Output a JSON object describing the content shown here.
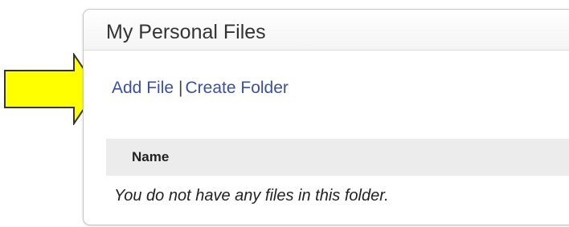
{
  "panel": {
    "title": "My Personal Files"
  },
  "actions": {
    "add_file_label": "Add File",
    "separator": "|",
    "create_folder_label": "Create Folder"
  },
  "table": {
    "columns": [
      "Name"
    ],
    "empty_message": "You do not have any files in this folder."
  },
  "annotation": {
    "arrow_icon": "right-arrow-icon",
    "arrow_color": "#ffff00",
    "arrow_outline": "#333333"
  },
  "colors": {
    "link": "#3a4fa8",
    "header_bg": "#ececec"
  }
}
